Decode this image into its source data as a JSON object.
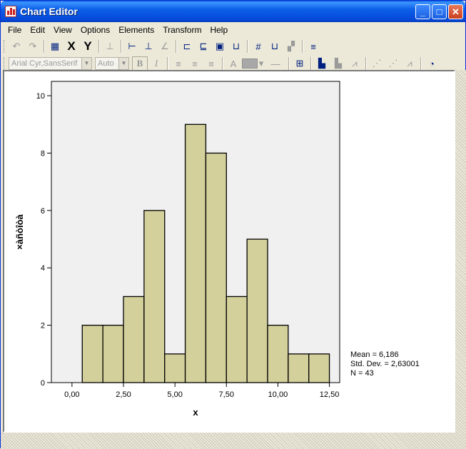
{
  "window": {
    "title": "Chart Editor"
  },
  "title_buttons": {
    "minimize": "_",
    "maximize": "□",
    "close": "✕"
  },
  "menu": [
    "File",
    "Edit",
    "View",
    "Options",
    "Elements",
    "Transform",
    "Help"
  ],
  "toolbar1": {
    "x_label": "X",
    "y_label": "Y"
  },
  "toolbar2": {
    "font": "Arial Cyr,SansSerif",
    "size": "Auto",
    "bold": "B",
    "italic": "I",
    "text_color": "A"
  },
  "chart_data": {
    "type": "bar",
    "chart_kind": "histogram",
    "bins": [
      [
        0.5,
        1.5
      ],
      [
        1.5,
        2.5
      ],
      [
        2.5,
        3.5
      ],
      [
        3.5,
        4.5
      ],
      [
        4.5,
        5.5
      ],
      [
        5.5,
        6.5
      ],
      [
        6.5,
        7.5
      ],
      [
        7.5,
        8.5
      ],
      [
        8.5,
        9.5
      ],
      [
        9.5,
        10.5
      ],
      [
        10.5,
        11.5
      ],
      [
        11.5,
        12.5
      ]
    ],
    "values": [
      2,
      2,
      3,
      6,
      1,
      9,
      8,
      3,
      5,
      2,
      1,
      1
    ],
    "xlabel": "x",
    "ylabel": "×àñòîòà",
    "xlim": [
      -1,
      13
    ],
    "ylim": [
      0,
      10.5
    ],
    "x_ticks": [
      "0,00",
      "2,50",
      "5,00",
      "7,50",
      "10,00",
      "12,50"
    ],
    "x_tick_values": [
      0,
      2.5,
      5,
      7.5,
      10,
      12.5
    ],
    "y_ticks": [
      "0",
      "2",
      "4",
      "6",
      "8",
      "10"
    ],
    "y_tick_values": [
      0,
      2,
      4,
      6,
      8,
      10
    ],
    "grid": false,
    "plot_background": "#f0f0f0",
    "bar_color": "#d3d09b",
    "stats": {
      "mean": "Mean = 6,186",
      "std": "Std. Dev. = 2,63001",
      "n": "N = 43"
    }
  }
}
